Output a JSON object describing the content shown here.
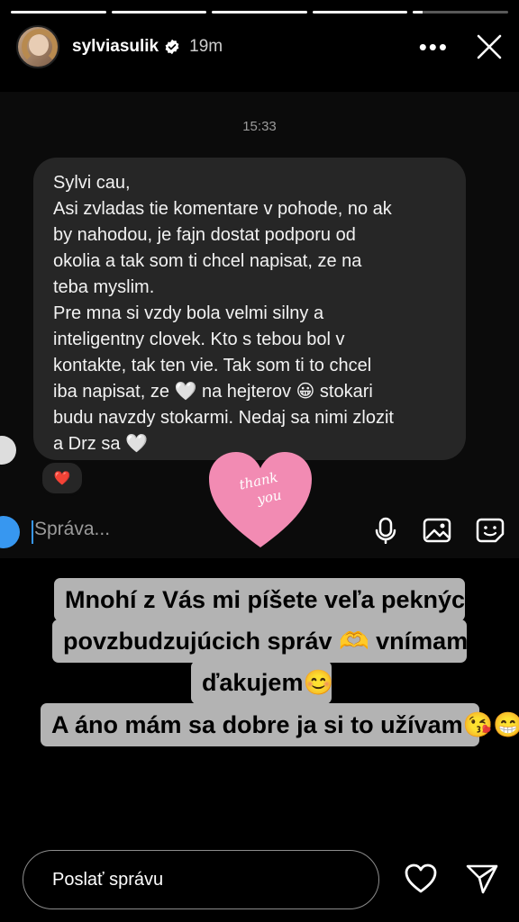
{
  "story": {
    "progress": [
      1,
      1,
      1,
      1,
      0.1
    ]
  },
  "header": {
    "username": "sylviasulik",
    "time": "19m",
    "more_label": "•••"
  },
  "dm": {
    "timestamp": "15:33",
    "message_lines": [
      "Sylvi cau,",
      "Asi zvladas tie komentare v pohode, no ak",
      "by nahodou, je fajn dostat podporu od",
      "okolia a tak som ti chcel napisat, ze na",
      "teba myslim.",
      "Pre mna si vzdy bola velmi silny a",
      "inteligentny clovek. Kto s tebou bol v",
      "kontakte, tak ten vie. Tak som ti to chcel",
      "iba napisat, ze 🤍 na hejterov 😀 stokari",
      "budu navzdy stokarmi. Nedaj sa nimi zlozit",
      "a Drz sa 🤍"
    ],
    "reaction": "❤️",
    "composer_placeholder": "Správa..."
  },
  "sticker": {
    "text_line1": "thank",
    "text_line2": "you",
    "color": "#f28bb3"
  },
  "caption": {
    "lines": [
      "Mnohí z Vás mi píšete veľa pekných a",
      "povzbudzujúcich správ 🫶 vnímam ich",
      "ďakujem😊",
      "A áno mám sa dobre ja si to užívam😘😁"
    ]
  },
  "footer": {
    "reply_placeholder": "Poslať správu"
  },
  "colors": {
    "accent": "#3797f0",
    "bubble": "#262626",
    "caption_bg": "#b3b3b3"
  }
}
